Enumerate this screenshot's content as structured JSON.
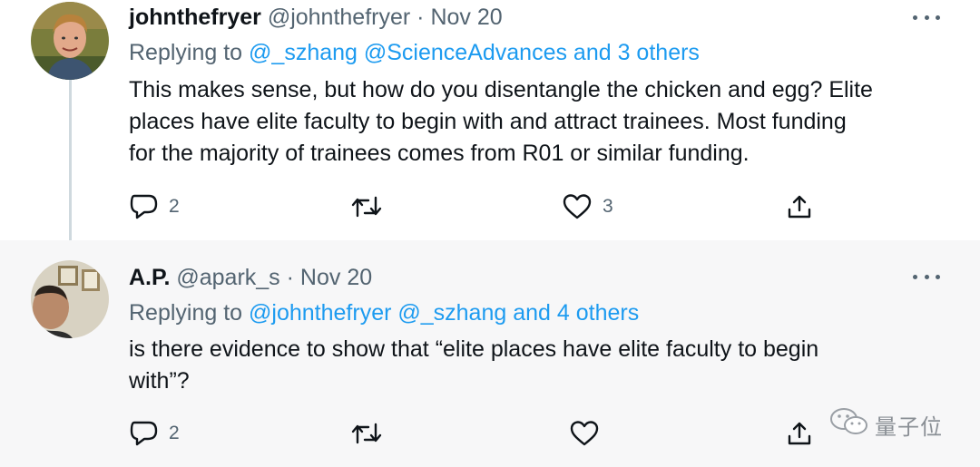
{
  "tweets": [
    {
      "name": "johnthefryer",
      "handle": "@johnthefryer",
      "separator": "·",
      "date": "Nov 20",
      "replying_prefix": "Replying to",
      "replying_to": "@_szhang @ScienceAdvances and 3 others",
      "text_lines": [
        "This makes sense, but how do you disentangle the chicken and egg? Elite",
        "places have elite faculty to begin with and attract trainees. Most funding",
        "for the majority of trainees comes from R01 or similar funding."
      ],
      "reply_count": "2",
      "retweet_count": "",
      "like_count": "3",
      "icons": {
        "reply": "reply-bubble-icon",
        "retweet": "retweet-icon",
        "like": "heart-icon",
        "share": "share-upload-icon",
        "more": "more-dots-icon"
      }
    },
    {
      "name": "A.P.",
      "handle": "@apark_s",
      "separator": "·",
      "date": "Nov 20",
      "replying_prefix": "Replying to",
      "replying_to": "@johnthefryer @_szhang and 4 others",
      "text_lines": [
        "is there evidence to show that “elite places have elite faculty to begin",
        "with”?"
      ],
      "reply_count": "2",
      "retweet_count": "",
      "like_count": "",
      "icons": {
        "reply": "reply-bubble-icon",
        "retweet": "retweet-icon",
        "like": "heart-icon",
        "share": "share-upload-icon",
        "more": "more-dots-icon"
      }
    }
  ],
  "watermark": {
    "text": "量子位",
    "icon": "wechat-icon"
  },
  "colors": {
    "link": "#1d9bf0",
    "secondary_text": "#536471",
    "primary_text": "#0f1419",
    "thread_line": "#cfd9de",
    "highlight_background": "#f7f7f8"
  }
}
